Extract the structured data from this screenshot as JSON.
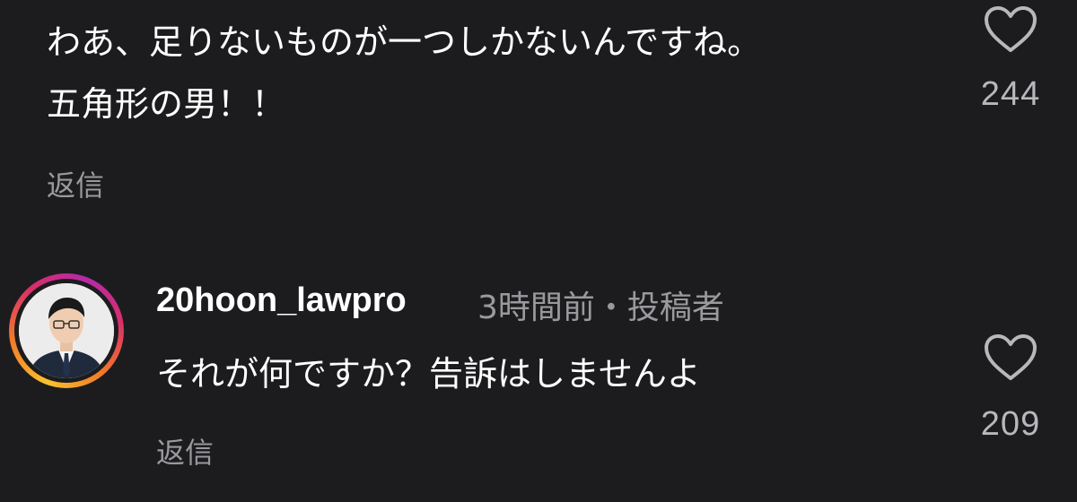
{
  "comments": [
    {
      "lines": [
        "わあ、足りないものが一つしかないんですね。",
        "五角形の男！！"
      ],
      "reply_label": "返信",
      "like_count": "244",
      "like_icon": "heart-outline-icon"
    },
    {
      "username": "20hoon_lawpro",
      "time": "3時間前",
      "separator": "・",
      "author_badge": "投稿者",
      "avatar_icon": "person-avatar",
      "text": "それが何ですか？告訴はしませんよ",
      "reply_label": "返信",
      "like_count": "209",
      "like_icon": "heart-outline-icon"
    }
  ],
  "colors": {
    "background": "#1c1c1e",
    "primary_text": "#ffffff",
    "secondary_text": "#9a9a9e",
    "like_count": "#b8b8bc"
  }
}
